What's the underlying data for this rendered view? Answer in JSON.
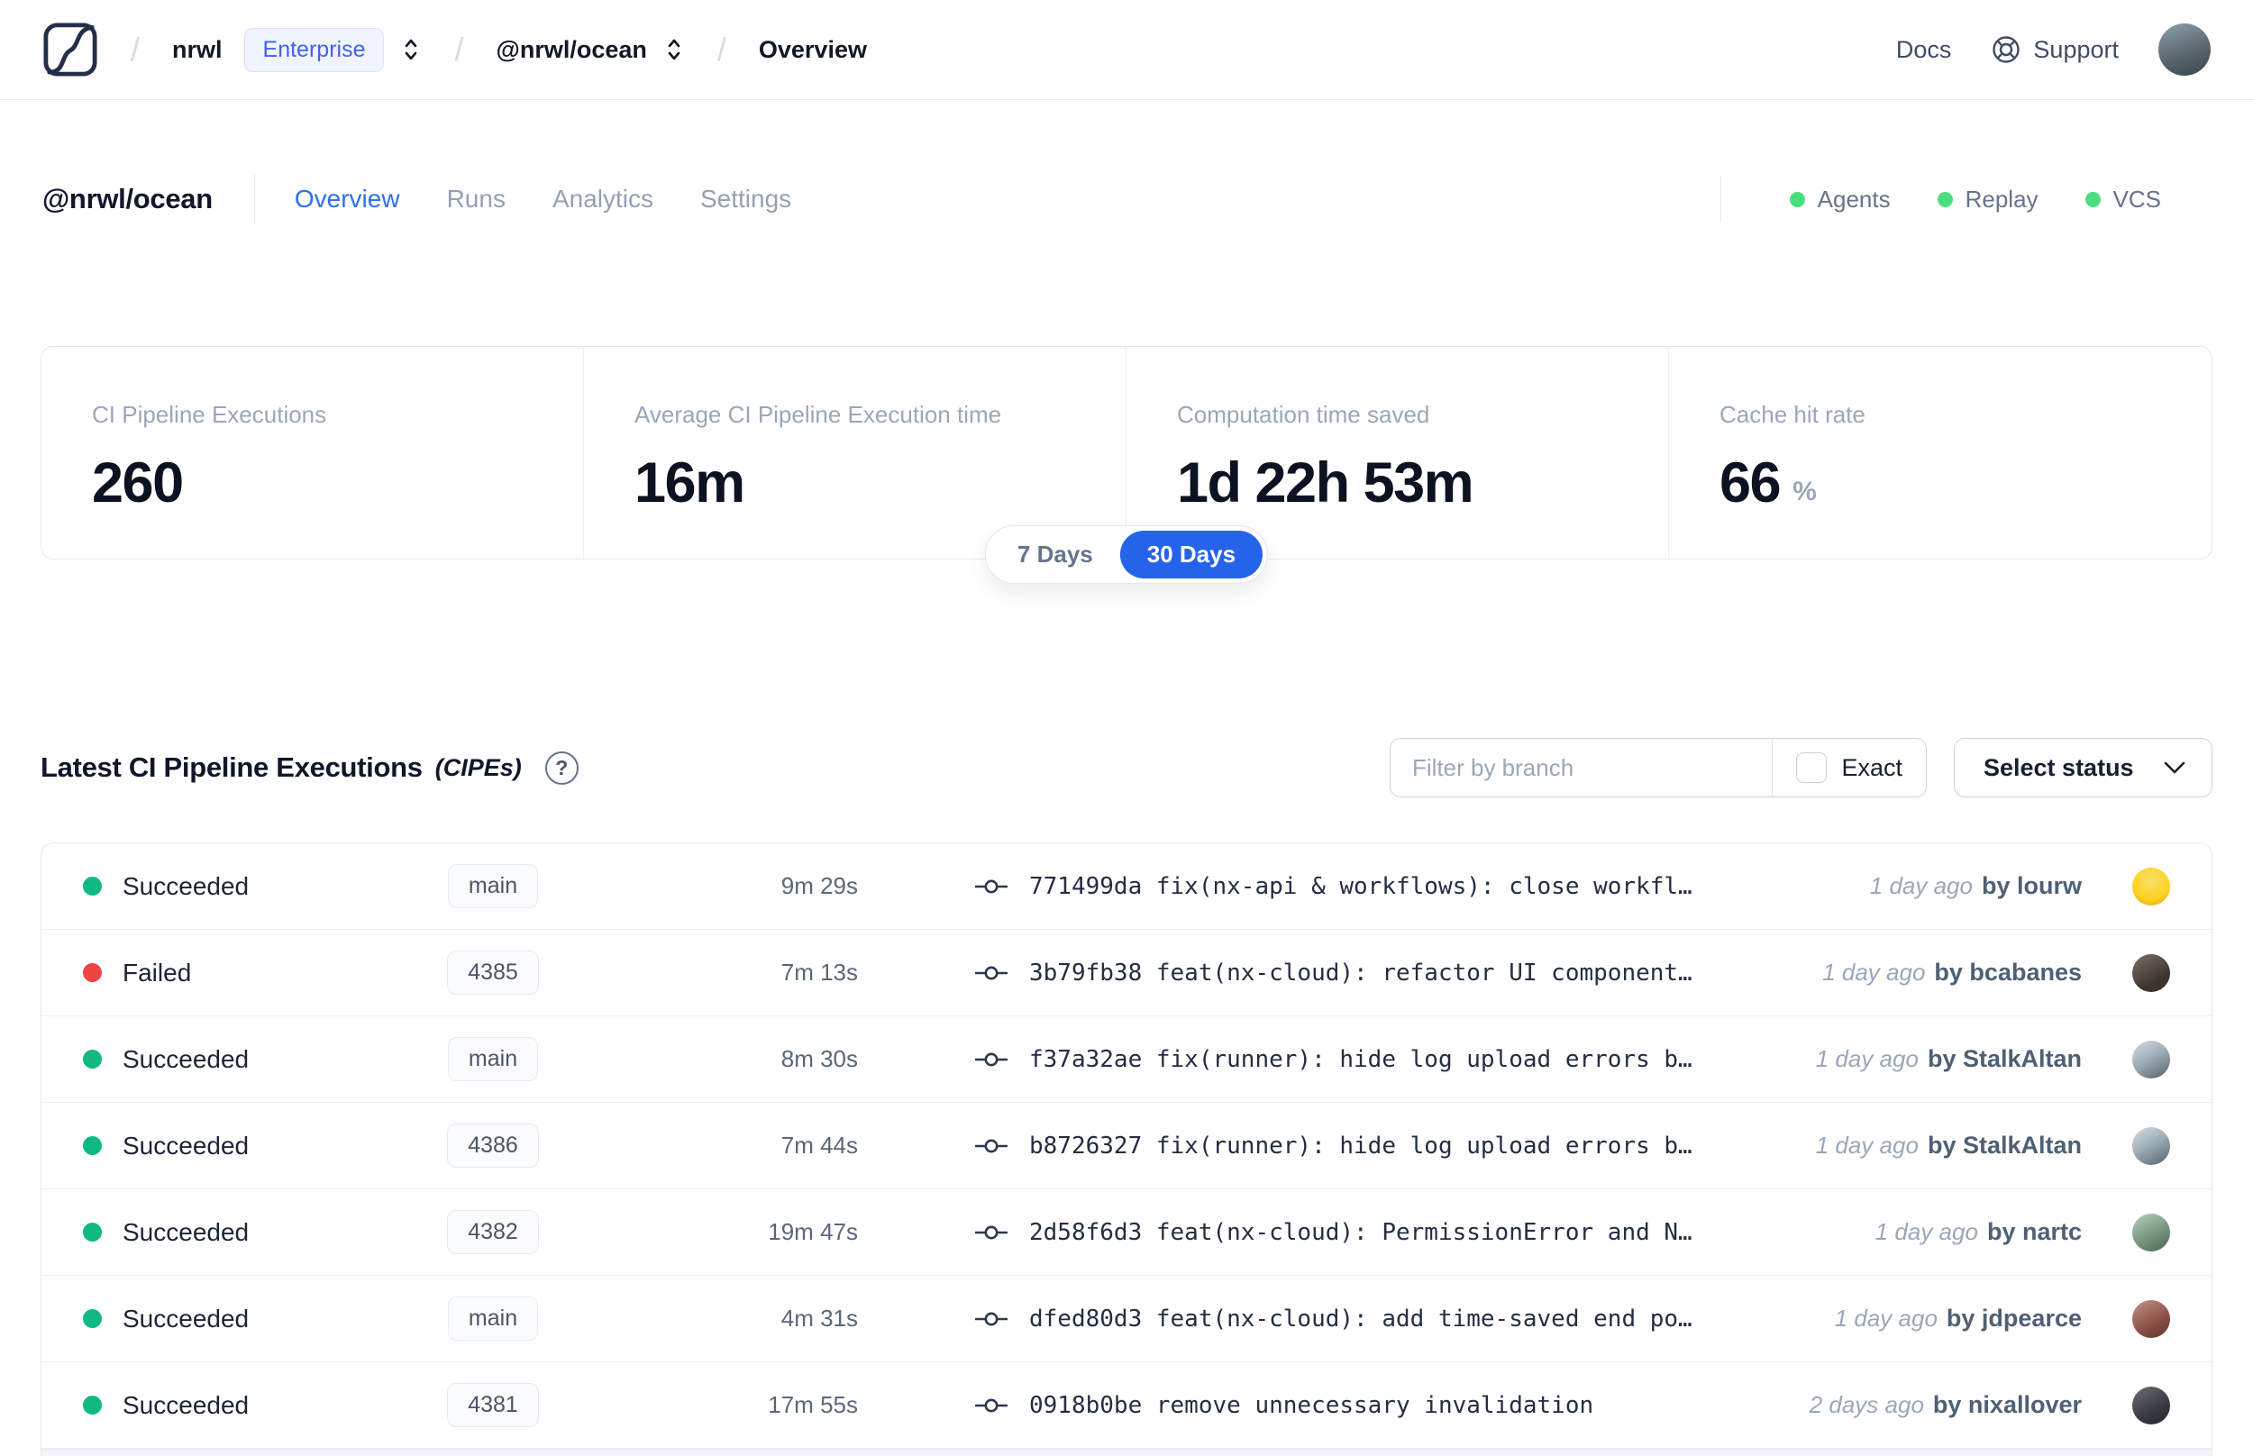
{
  "topbar": {
    "breadcrumb": {
      "separator": "/",
      "org": "nrwl",
      "org_badge": "Enterprise",
      "workspace": "@nrwl/ocean",
      "page": "Overview"
    },
    "docs_label": "Docs",
    "support_label": "Support"
  },
  "workspace_header": {
    "title": "@nrwl/ocean",
    "tabs": [
      {
        "label": "Overview",
        "active": true
      },
      {
        "label": "Runs",
        "active": false
      },
      {
        "label": "Analytics",
        "active": false
      },
      {
        "label": "Settings",
        "active": false
      }
    ],
    "features": [
      {
        "label": "Agents",
        "status_color": "#4ade80"
      },
      {
        "label": "Replay",
        "status_color": "#4ade80"
      },
      {
        "label": "VCS",
        "status_color": "#4ade80"
      }
    ]
  },
  "stats": {
    "cards": [
      {
        "label": "CI Pipeline Executions",
        "value": "260",
        "suffix": ""
      },
      {
        "label": "Average CI Pipeline Execution time",
        "value": "16m",
        "suffix": ""
      },
      {
        "label": "Computation time saved",
        "value": "1d 22h 53m",
        "suffix": ""
      },
      {
        "label": "Cache hit rate",
        "value": "66",
        "suffix": "%"
      }
    ],
    "range_toggle": {
      "options": [
        "7 Days",
        "30 Days"
      ],
      "selected": "30 Days"
    }
  },
  "cipes": {
    "title": "Latest CI Pipeline Executions",
    "title_suffix": "(CIPEs)",
    "help_glyph": "?",
    "filter_placeholder": "Filter by branch",
    "exact_label": "Exact",
    "status_select_label": "Select status",
    "rows": [
      {
        "status": "Succeeded",
        "dot_class": "dot green",
        "branch": "main",
        "duration": "9m 29s",
        "commit": "771499da fix(nx-api & workflows): close workfl…",
        "time_ago": "1 day ago",
        "author": "by lourw"
      },
      {
        "status": "Failed",
        "dot_class": "dot red",
        "branch": "4385",
        "duration": "7m 13s",
        "commit": "3b79fb38 feat(nx-cloud): refactor UI component…",
        "time_ago": "1 day ago",
        "author": "by bcabanes"
      },
      {
        "status": "Succeeded",
        "dot_class": "dot green",
        "branch": "main",
        "duration": "8m 30s",
        "commit": "f37a32ae fix(runner): hide log upload errors b…",
        "time_ago": "1 day ago",
        "author": "by StalkAltan"
      },
      {
        "status": "Succeeded",
        "dot_class": "dot green",
        "branch": "4386",
        "duration": "7m 44s",
        "commit": "b8726327 fix(runner): hide log upload errors b…",
        "time_ago": "1 day ago",
        "author": "by StalkAltan"
      },
      {
        "status": "Succeeded",
        "dot_class": "dot green",
        "branch": "4382",
        "duration": "19m 47s",
        "commit": "2d58f6d3 feat(nx-cloud): PermissionError and N…",
        "time_ago": "1 day ago",
        "author": "by nartc"
      },
      {
        "status": "Succeeded",
        "dot_class": "dot green",
        "branch": "main",
        "duration": "4m 31s",
        "commit": "dfed80d3 feat(nx-cloud): add time-saved end po…",
        "time_ago": "1 day ago",
        "author": "by jdpearce"
      },
      {
        "status": "Succeeded",
        "dot_class": "dot green",
        "branch": "4381",
        "duration": "17m 55s",
        "commit": "0918b0be remove unnecessary invalidation",
        "time_ago": "2 days ago",
        "author": "by nixallover"
      }
    ]
  },
  "icons": {
    "logo": "nx-cloud-logo",
    "breadcrumb_expander": "chevron-up-down",
    "support": "life-buoy",
    "help": "question-circle",
    "commit": "git-commit",
    "select_chevron": "chevron-down"
  },
  "colors": {
    "accent_blue": "#2563eb",
    "tab_active_blue": "#2f6fed",
    "success_green": "#10b981",
    "failed_red": "#ef4444",
    "feature_dot_green": "#4ade80",
    "badge_blue_text": "#4263eb",
    "badge_blue_bg": "#f0f4ff"
  }
}
